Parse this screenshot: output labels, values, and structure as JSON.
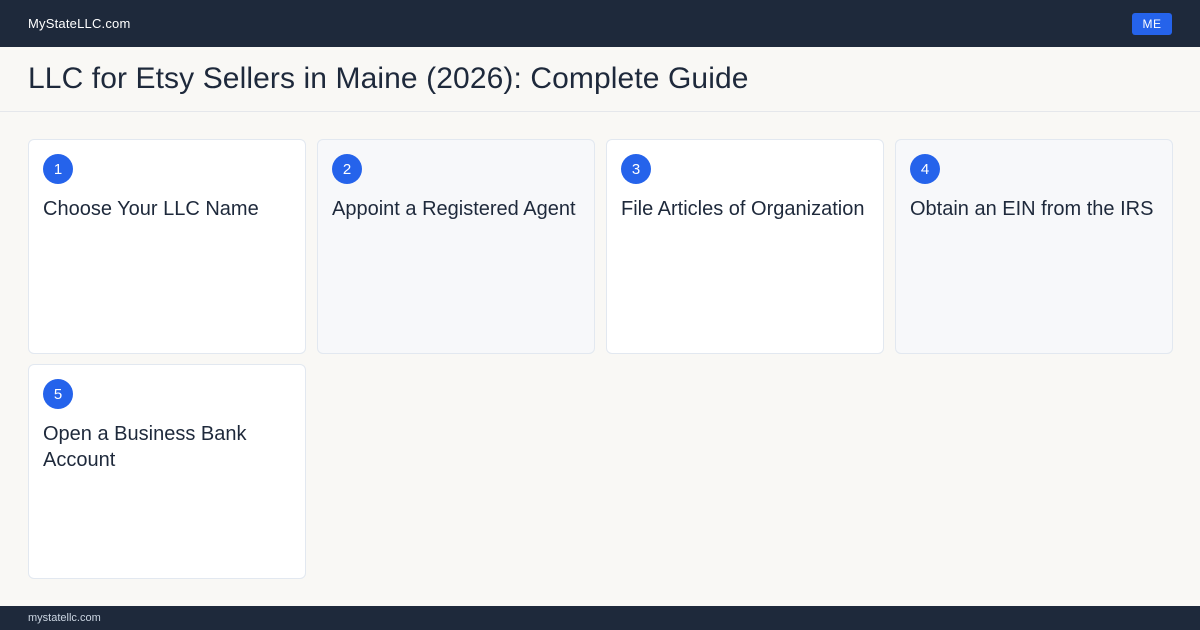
{
  "header": {
    "brand": "MyStateLLC.com",
    "state_badge": "ME"
  },
  "page": {
    "title": "LLC for Etsy Sellers in Maine (2026): Complete Guide"
  },
  "steps": [
    {
      "number": "1",
      "title": "Choose Your LLC Name"
    },
    {
      "number": "2",
      "title": "Appoint a Registered Agent"
    },
    {
      "number": "3",
      "title": "File Articles of Organization"
    },
    {
      "number": "4",
      "title": "Obtain an EIN from the IRS"
    },
    {
      "number": "5",
      "title": "Open a Business Bank Account"
    }
  ],
  "footer": {
    "domain": "mystatellc.com"
  },
  "colors": {
    "nav_background": "#1e293b",
    "accent": "#2563eb",
    "page_background": "#f9f8f5"
  }
}
